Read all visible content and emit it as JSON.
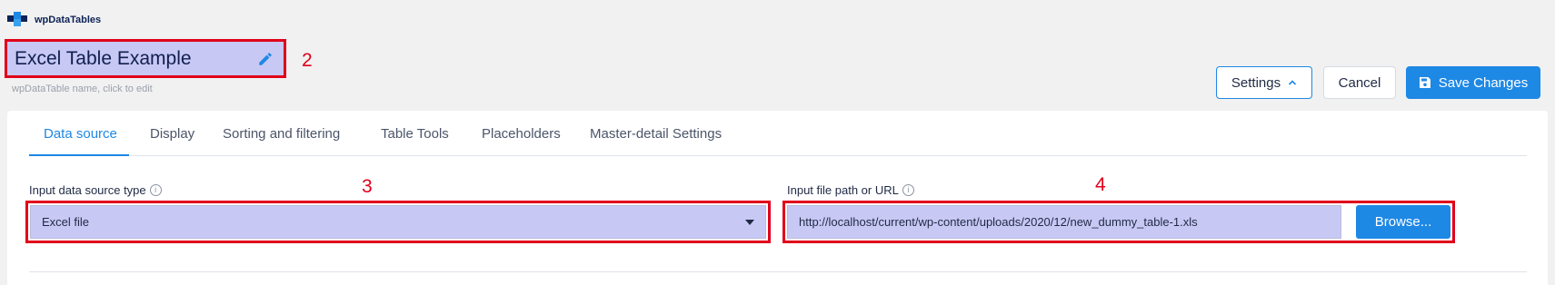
{
  "brand": {
    "name": "wpDataTables"
  },
  "table_title": {
    "value": "Excel Table Example",
    "hint": "wpDataTable name, click to edit"
  },
  "markers": {
    "m2": "2",
    "m3": "3",
    "m4": "4"
  },
  "header_buttons": {
    "settings": "Settings",
    "cancel": "Cancel",
    "save": "Save Changes"
  },
  "tabs": [
    {
      "label": "Data source",
      "active": true
    },
    {
      "label": "Display",
      "active": false
    },
    {
      "label": "Sorting and filtering",
      "active": false
    },
    {
      "label": "Table Tools",
      "active": false
    },
    {
      "label": "Placeholders",
      "active": false
    },
    {
      "label": "Master-detail Settings",
      "active": false
    }
  ],
  "data_source": {
    "type_label": "Input data source type",
    "type_value": "Excel file",
    "path_label": "Input file path or URL",
    "path_value": "http://localhost/current/wp-content/uploads/2020/12/new_dummy_table-1.xls",
    "browse_label": "Browse..."
  },
  "colors": {
    "accent": "#1e88e5",
    "highlight_fill": "#c8c8f5",
    "annotation_red": "#e0001a"
  }
}
